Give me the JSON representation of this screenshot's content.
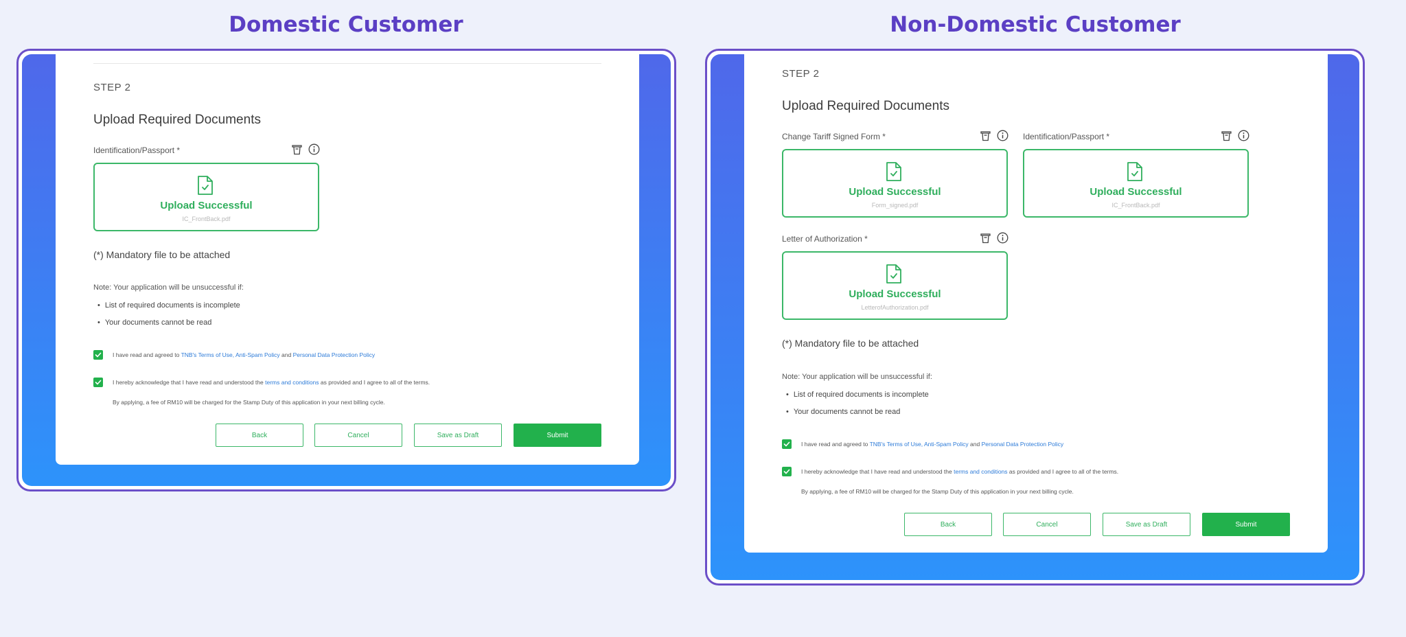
{
  "titles": {
    "domestic": "Domestic Customer",
    "non_domestic": "Non-Domestic Customer"
  },
  "icons": {
    "delete": "trash-icon",
    "info": "info-icon",
    "document": "document-check-icon",
    "checkbox": "checkmark-icon"
  },
  "colors": {
    "accent_purple": "#5b3fc4",
    "success_green": "#22b14c",
    "link_blue": "#2d7bd8",
    "gradient_top": "#4f68ea",
    "gradient_bottom": "#2d93fb"
  },
  "domestic": {
    "step": "STEP 2",
    "heading": "Upload Required Documents",
    "uploads": [
      {
        "label": "Identification/Passport *",
        "status": "Upload Successful",
        "file": "IC_FrontBack.pdf"
      }
    ],
    "mandatory": "(*) Mandatory file to be attached",
    "note": "Note: Your application will be unsuccessful if:",
    "bullets": [
      "List of required documents is incomplete",
      "Your documents cannot be read"
    ],
    "terms1": {
      "pre": "I have read and agreed to ",
      "link1": "TNB's Terms of Use, Anti-Spam Policy",
      "mid": " and ",
      "link2": "Personal Data Protection Policy"
    },
    "terms2": {
      "pre": "I hereby acknowledge that I have read and understood the ",
      "link": "terms and conditions",
      "post": " as provided and I agree to all of the terms."
    },
    "fee": "By applying, a fee of RM10 will be charged for the Stamp Duty of this application in your next billing cycle.",
    "buttons": {
      "back": "Back",
      "cancel": "Cancel",
      "draft": "Save as Draft",
      "submit": "Submit"
    }
  },
  "non_domestic": {
    "step": "STEP 2",
    "heading": "Upload Required Documents",
    "uploads": [
      {
        "label": "Change Tariff Signed Form *",
        "status": "Upload Successful",
        "file": "Form_signed.pdf"
      },
      {
        "label": "Identification/Passport *",
        "status": "Upload Successful",
        "file": "IC_FrontBack.pdf"
      },
      {
        "label": "Letter of Authorization *",
        "status": "Upload Successful",
        "file": "LetterofAuthorization.pdf"
      }
    ],
    "mandatory": "(*) Mandatory file to be attached",
    "note": "Note: Your application will be unsuccessful if:",
    "bullets": [
      "List of required documents is incomplete",
      "Your documents cannot be read"
    ],
    "terms1": {
      "pre": "I have read and agreed to ",
      "link1": "TNB's Terms of Use, Anti-Spam Policy",
      "mid": " and ",
      "link2": "Personal Data Protection Policy"
    },
    "terms2": {
      "pre": "I hereby acknowledge that I have read and understood the ",
      "link": "terms and conditions",
      "post": " as provided and I agree to all of the terms."
    },
    "fee": "By applying, a fee of RM10 will be charged for the Stamp Duty of this application in your next billing cycle.",
    "buttons": {
      "back": "Back",
      "cancel": "Cancel",
      "draft": "Save as Draft",
      "submit": "Submit"
    }
  }
}
